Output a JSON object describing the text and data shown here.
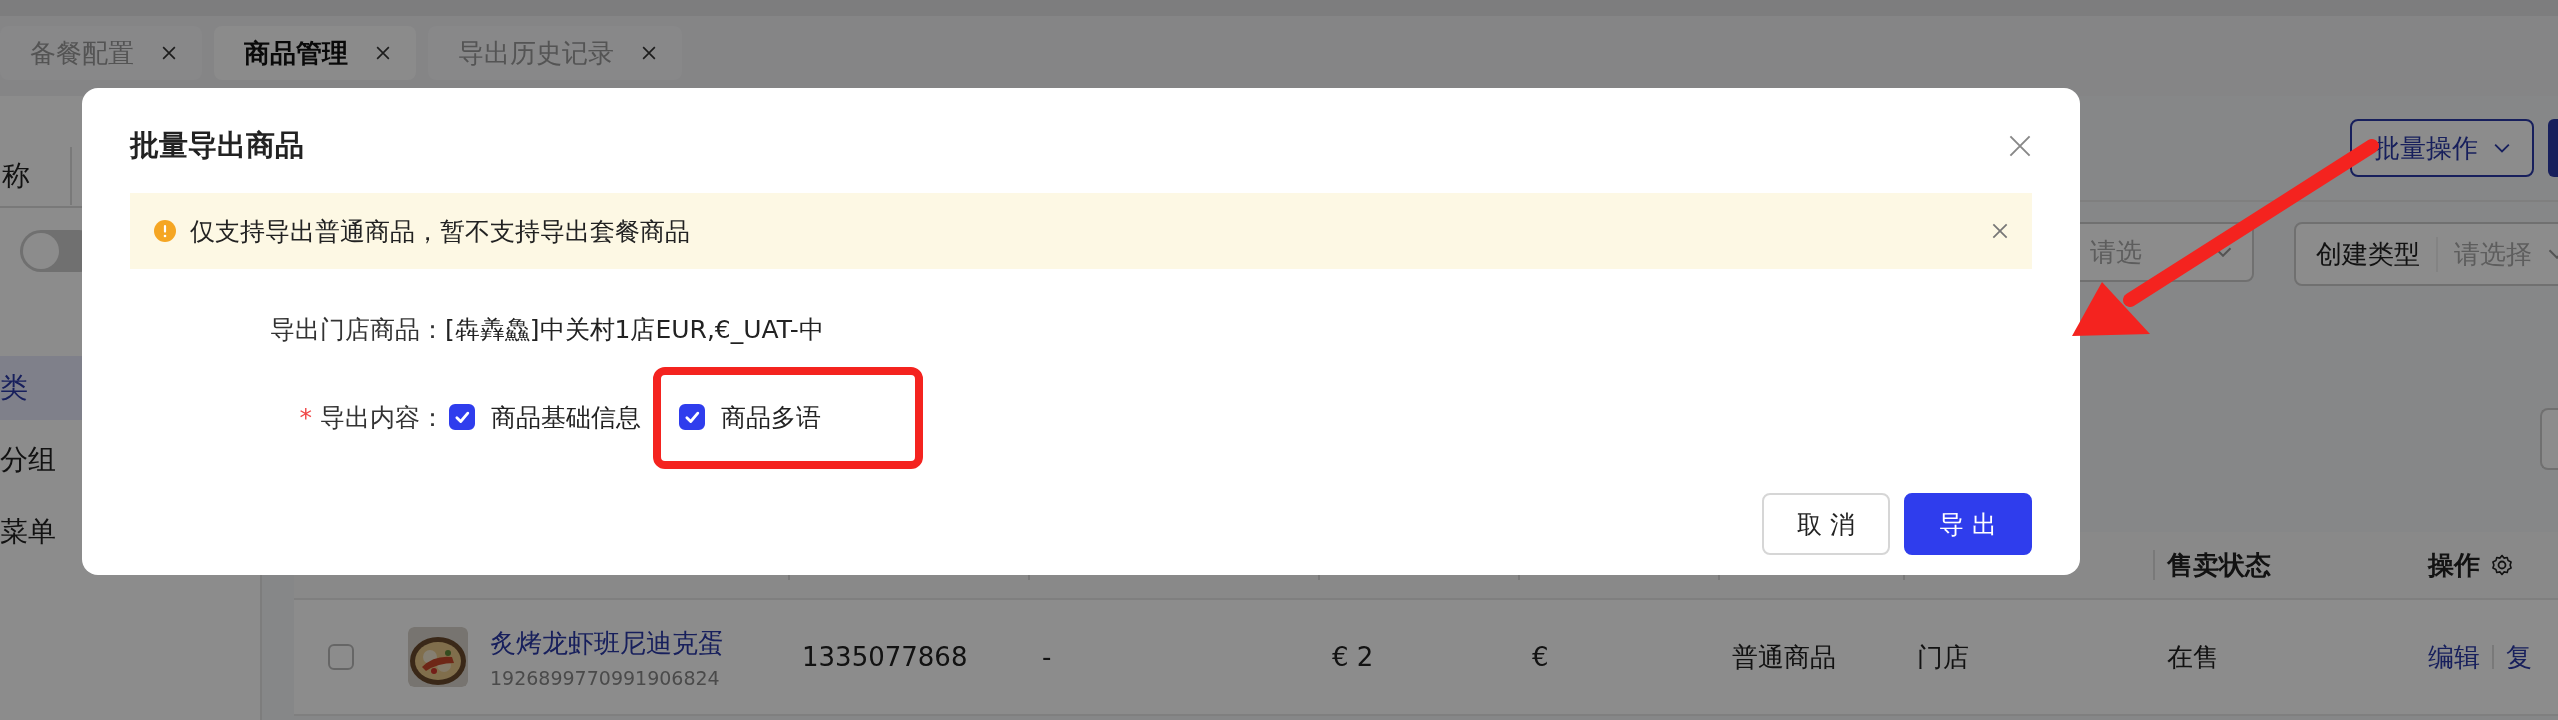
{
  "tabs": [
    {
      "label": "备餐配置",
      "selected": false,
      "closable": true
    },
    {
      "label": "商品管理",
      "selected": true,
      "closable": true
    },
    {
      "label": "导出历史记录",
      "selected": false,
      "closable": true
    }
  ],
  "toolbar": {
    "batch_button": "批量操作"
  },
  "filters": [
    {
      "placeholder": "请选"
    },
    {
      "label": "创建类型",
      "placeholder": "请选择"
    }
  ],
  "sidebar": {
    "search_label": "称",
    "toggle": {
      "on": false
    },
    "items": [
      {
        "label": "类",
        "selected": true
      },
      {
        "label": "分组",
        "selected": false
      },
      {
        "label": "菜单",
        "selected": false
      }
    ]
  },
  "table": {
    "columns": [
      null,
      null,
      null,
      null,
      null,
      null,
      {
        "label": "售卖状态"
      },
      {
        "label": "操作"
      }
    ],
    "rows": [
      {
        "checked": false,
        "name": "炙烤龙虾班尼迪克蛋",
        "id": "1926899770991906824",
        "image": {
          "kind": "picture"
        },
        "cells": [
          "1335077868",
          "-",
          "€  2",
          "€",
          "普通商品",
          "门店",
          "在售"
        ],
        "actions": [
          "编辑",
          "复"
        ]
      }
    ]
  },
  "dialog": {
    "title": "批量导出商品",
    "alert": {
      "text": "仅支持导出普通商品，暂不支持导出套餐商品",
      "closable": true
    },
    "store_label": "导出门店商品：",
    "store_value": "[犇羴鱻]中关村1店EUR,€_UAT-中",
    "content_label": "导出内容：",
    "required_mark": "*",
    "options": [
      {
        "label": "商品基础信息",
        "checked": true,
        "highlighted": false
      },
      {
        "label": "商品多语",
        "checked": true,
        "highlighted": true
      }
    ],
    "buttons": [
      {
        "label": "取 消",
        "kind": "default"
      },
      {
        "label": "导 出",
        "kind": "primary"
      }
    ]
  },
  "annotation": {
    "arrow": true
  }
}
